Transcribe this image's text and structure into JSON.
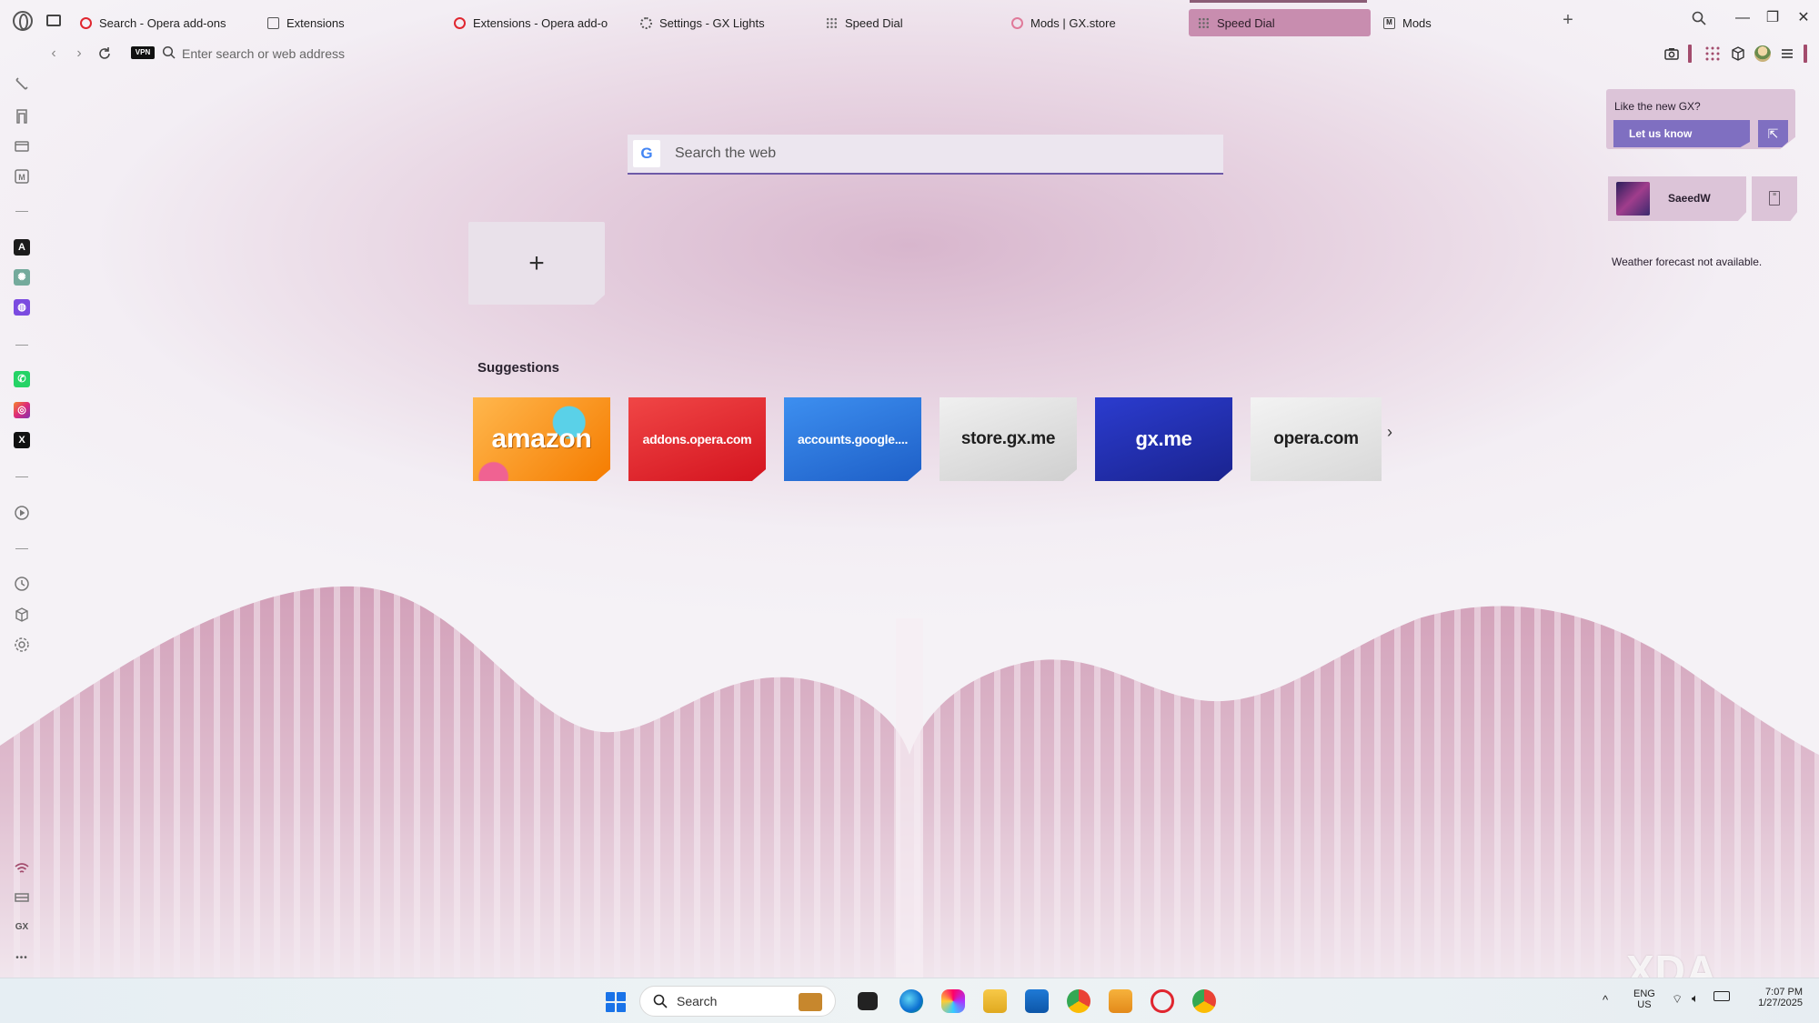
{
  "browser": {
    "tabs": [
      {
        "label": "Search - Opera add-ons",
        "icon": "opera-icon"
      },
      {
        "label": "Extensions",
        "icon": "cube-icon"
      },
      {
        "label": "Extensions - Opera add-o",
        "icon": "opera-icon"
      },
      {
        "label": "Settings - GX Lights",
        "icon": "gear-icon"
      },
      {
        "label": "Speed Dial",
        "icon": "speed-dial-icon"
      },
      {
        "label": "Mods | GX.store",
        "icon": "gx-store-icon"
      },
      {
        "label": "Speed Dial",
        "icon": "speed-dial-icon",
        "active": true
      },
      {
        "label": "Mods",
        "icon": "mods-icon"
      }
    ],
    "window_controls": {
      "minimize": "—",
      "restore": "❐",
      "close": "✕"
    },
    "new_tab": "+"
  },
  "address_bar": {
    "vpn_label": "VPN",
    "placeholder": "Enter search or web address",
    "value": ""
  },
  "sidebar": {
    "apps": [
      {
        "name": "aria",
        "letter": "A",
        "color": "#1c1c1c"
      },
      {
        "name": "chatgpt",
        "letter": "✺",
        "color": "#74aa9c"
      },
      {
        "name": "messenger",
        "letter": "◍",
        "color": "#7b4be0"
      },
      {
        "name": "whatsapp",
        "letter": "✆",
        "color": "#25d366"
      },
      {
        "name": "instagram",
        "letter": "◎",
        "color": "#d6336c"
      },
      {
        "name": "x",
        "letter": "X",
        "color": "#111111"
      }
    ],
    "gx_label": "GX",
    "more_label": "•••"
  },
  "search": {
    "engine_letter": "G",
    "placeholder": "Search the web",
    "value": ""
  },
  "speed_dial": {
    "add_label": "+",
    "suggestions_title": "Suggestions",
    "suggestions": [
      {
        "label": "amazon",
        "bg": "#f59b1a",
        "fg": "#ffffff"
      },
      {
        "label": "addons.opera.com",
        "bg": "#e0262f",
        "fg": "#ffffff"
      },
      {
        "label": "accounts.google....",
        "bg": "#2f7de1",
        "fg": "#ffffff"
      },
      {
        "label": "store.gx.me",
        "bg": "#e2e2e2",
        "fg": "#1e1e1e"
      },
      {
        "label": "gx.me",
        "bg": "#2330b5",
        "fg": "#ffffff"
      },
      {
        "label": "opera.com",
        "bg": "#e8e8e8",
        "fg": "#1e1e1e"
      }
    ],
    "next_label": "›"
  },
  "right_panel": {
    "feedback_question": "Like the new GX?",
    "feedback_button": "Let us know",
    "user_name": "SaeedW",
    "weather": "Weather forecast not available."
  },
  "watermark": "XDA",
  "taskbar": {
    "search_placeholder": "Search",
    "language": "ENG",
    "region": "US",
    "time": "7:07 PM",
    "date": "1/27/2025",
    "chevron": "^"
  }
}
